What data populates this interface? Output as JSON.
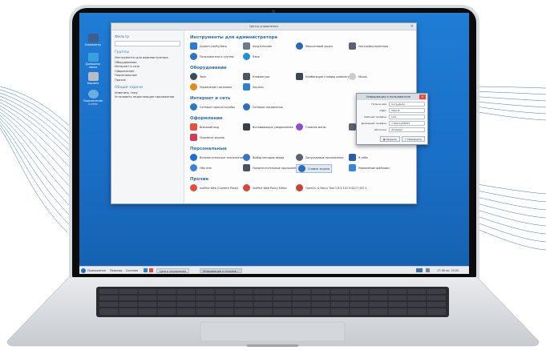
{
  "desktop": {
    "icons": [
      {
        "label": "Компьютер",
        "color": "#3e5f8e"
      },
      {
        "label": "Домашняя папка",
        "color": "#3aa0e0"
      },
      {
        "label": "Корзина",
        "color": "#b7bcc4"
      },
      {
        "label": "Подключение к сети",
        "color": "#6aaee6"
      }
    ]
  },
  "window": {
    "title": "Центр управления",
    "close_glyph": "×",
    "sidebar": {
      "search_heading": "Фильтр",
      "groups_heading": "Группы",
      "groups": [
        "Инструменты для администратора",
        "Оборудование",
        "Интернет и сеть",
        "Оформление",
        "Персональные",
        "Прочие"
      ],
      "tasks_heading": "Общие задачи",
      "tasks": [
        "Изменить тему",
        "Установить недостающие приложения"
      ]
    },
    "sections": [
      {
        "title": "Инструменты для администратора",
        "apps": [
          {
            "label": "System Config Data",
            "color": "#2e7bd1"
          },
          {
            "label": "Xorg-Extender",
            "color": "#6d7a88"
          },
          {
            "label": "Межсетевой экран",
            "color": "#2a67b8"
          },
          {
            "label": "Настройка принтера",
            "color": "#5a6170"
          },
          {
            "label": "Пользователи и группы",
            "color": "#2d73c9"
          },
          {
            "label": "Язык",
            "color": "#1f8fe0"
          }
        ]
      },
      {
        "title": "Оборудование",
        "apps": [
          {
            "label": "Звук",
            "color": "#3b4a5e"
          },
          {
            "label": "Клавиатура",
            "color": "#4b5563"
          },
          {
            "label": "Комбинации клавиш клавиатуры",
            "color": "#3d4652"
          },
          {
            "label": "Мышь",
            "color": "#c9cdd2"
          },
          {
            "label": "Управление питанием",
            "color": "#e28a1a"
          },
          {
            "label": "Экраны",
            "color": "#2f7fd0"
          }
        ]
      },
      {
        "title": "Интернет и сеть",
        "apps": [
          {
            "label": "Сетевые прокси-службы",
            "color": "#2b78c9"
          },
          {
            "label": "Сетевые соединения",
            "color": "#2d6fbf"
          }
        ]
      },
      {
        "title": "Оформление",
        "apps": [
          {
            "label": "Внешний вид",
            "color": "#e2553c"
          },
          {
            "label": "Всплывающие уведомления",
            "color": "#3c3f44"
          },
          {
            "label": "Главное меню",
            "color": "#8a4fd0"
          },
          {
            "label": "Шаги",
            "color": "#5a6270"
          },
          {
            "label": "Просмотр экрана",
            "color": "#d23c5a"
          }
        ]
      },
      {
        "title": "Персональные",
        "apps": [
          {
            "label": "Вспомогательные технологии",
            "color": "#1e6fd0"
          },
          {
            "label": "Выбор методов ввода",
            "color": "#3c72c9"
          },
          {
            "label": "Запускаемые приложения",
            "color": "#5b6574"
          },
          {
            "label": "Я себе",
            "color": "#2d5ca8"
          },
          {
            "label": "Обо мне",
            "color": "#3b82d6"
          },
          {
            "label": "Предпочтительные приложения",
            "color": "#4a5160"
          },
          {
            "label": "Снимок экрана",
            "color": "#2b6cc0"
          },
          {
            "label": "Управление файлами",
            "color": "#3489d9"
          }
        ]
      },
      {
        "title": "Прочие",
        "apps": [
          {
            "label": "Inoffice Web (Content Panel)",
            "color": "#e64b3b"
          },
          {
            "label": "Inoffice Web Policy Editor",
            "color": "#d9473a"
          },
          {
            "label": "OpenGL & Policy Tool 1.8.4.121.9.6277.397.1",
            "color": "#c6433a"
          }
        ]
      }
    ]
  },
  "dialog": {
    "title": "Информация о пользователе",
    "close_glyph": "×",
    "fields": [
      {
        "label": "Полное имя",
        "value": "Сотрудник"
      },
      {
        "label": "Офис",
        "value": "Офис4"
      },
      {
        "label": "Рабочий телефон",
        "value": "123"
      },
      {
        "label": "Домашний телефон",
        "value": "7-000-1234567"
      },
      {
        "label": "Оболочка",
        "value": "/bin/bash"
      }
    ],
    "close_button": "Закрыть",
    "apply_button": "Применить"
  },
  "taskbar": {
    "menu": [
      "Приложения",
      "Переход",
      "Система"
    ],
    "windows": [
      "Центр управления",
      "Информация о пользов..."
    ],
    "clock": "17:38 пн, 23.05"
  }
}
